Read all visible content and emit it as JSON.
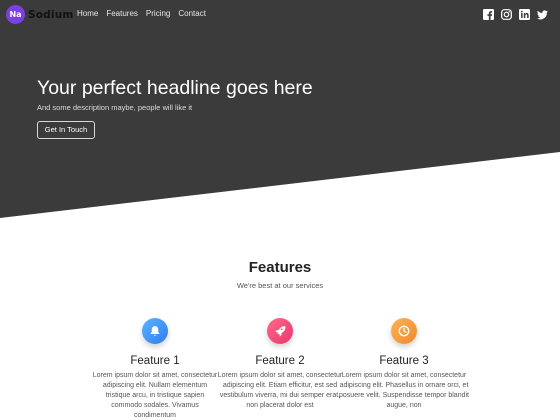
{
  "brand": {
    "badge": "Na",
    "name": "Sodium",
    "accent": "#7b3fe4"
  },
  "nav": {
    "links": [
      "Home",
      "Features",
      "Pricing",
      "Contact"
    ]
  },
  "socials": [
    "facebook-icon",
    "instagram-icon",
    "linkedin-icon",
    "twitter-icon"
  ],
  "hero": {
    "title": "Your perfect headline goes here",
    "subtitle": "And some description maybe, people will like it",
    "button": "Get In Touch",
    "background": "#3b3b3b"
  },
  "features": {
    "title": "Features",
    "subtitle": "We're best at our services",
    "items": [
      {
        "icon": "bell-icon",
        "color": "#3a8cf5",
        "name": "Feature 1",
        "text": "Lorem ipsum dolor sit amet, consectetur adipiscing elit. Nullam elementum tristique arcu, in tristique sapien commodo sodales. Vivamus condimentum"
      },
      {
        "icon": "rocket-icon",
        "color": "#ee4a7b",
        "name": "Feature 2",
        "text": "Lorem ipsum dolor sit amet, consectetur adipiscing elit. Etiam efficitur, est sed vestibulum viverra, mi dui semper erat, non placerat dolor est"
      },
      {
        "icon": "clock-icon",
        "color": "#f59a3a",
        "name": "Feature 3",
        "text": "Lorem ipsum dolor sit amet, consectetur adipiscing elit. Phasellus in ornare orci, et posuere velit. Suspendisse tempor blandit augue, non"
      }
    ]
  }
}
